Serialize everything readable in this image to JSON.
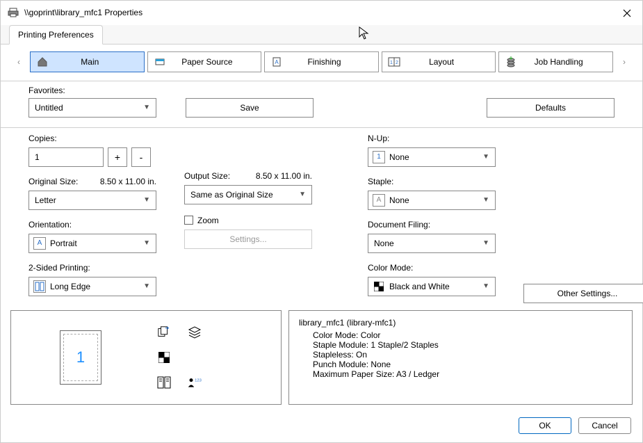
{
  "window": {
    "title": "\\\\goprint\\library_mfc1 Properties"
  },
  "tab": {
    "label": "Printing Preferences"
  },
  "nav": {
    "items": [
      {
        "label": "Main",
        "icon": "home-icon",
        "active": true
      },
      {
        "label": "Paper Source",
        "icon": "tray-icon",
        "active": false
      },
      {
        "label": "Finishing",
        "icon": "page-a-icon",
        "active": false
      },
      {
        "label": "Layout",
        "icon": "layout-icon",
        "active": false
      },
      {
        "label": "Job Handling",
        "icon": "job-icon",
        "active": false
      }
    ]
  },
  "favorites": {
    "label": "Favorites:",
    "value": "Untitled",
    "save_label": "Save",
    "defaults_label": "Defaults"
  },
  "left": {
    "copies_label": "Copies:",
    "copies_value": "1",
    "plus": "+",
    "minus": "-",
    "orig_size_label": "Original Size:",
    "orig_size_dim": "8.50 x 11.00 in.",
    "orig_size_value": "Letter",
    "orientation_label": "Orientation:",
    "orientation_value": "Portrait",
    "twosided_label": "2-Sided Printing:",
    "twosided_value": "Long Edge"
  },
  "mid": {
    "output_size_label": "Output Size:",
    "output_size_dim": "8.50 x 11.00 in.",
    "output_size_value": "Same as Original Size",
    "zoom_label": "Zoom",
    "settings_label": "Settings..."
  },
  "right": {
    "nup_label": "N-Up:",
    "nup_value": "None",
    "nup_icon_text": "1",
    "staple_label": "Staple:",
    "staple_value": "None",
    "docfiling_label": "Document Filing:",
    "docfiling_value": "None",
    "colormode_label": "Color Mode:",
    "colormode_value": "Black and White",
    "other_settings_label": "Other Settings..."
  },
  "preview": {
    "page_number": "1",
    "info_title": "library_mfc1 (library-mfc1)",
    "lines": {
      "l1": "Color Mode: Color",
      "l2": "Staple Module: 1 Staple/2 Staples",
      "l3": "Stapleless: On",
      "l4": "Punch Module: None",
      "l5": "Maximum Paper Size: A3 / Ledger"
    }
  },
  "footer": {
    "ok": "OK",
    "cancel": "Cancel"
  }
}
